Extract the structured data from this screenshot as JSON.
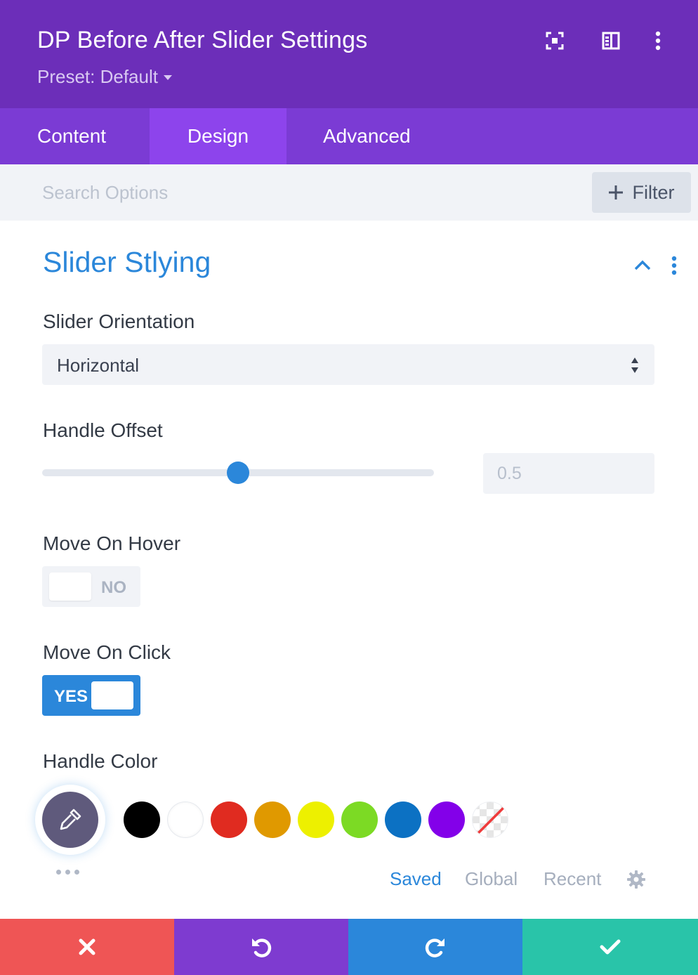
{
  "header": {
    "title": "DP Before After Slider Settings",
    "preset_label": "Preset: Default"
  },
  "tabs": [
    {
      "label": "Content"
    },
    {
      "label": "Design",
      "active": true
    },
    {
      "label": "Advanced"
    }
  ],
  "search": {
    "placeholder": "Search Options",
    "filter_label": "Filter"
  },
  "section": {
    "title": "Slider Stlying",
    "expanded": true
  },
  "fields": {
    "orientation": {
      "label": "Slider Orientation",
      "value": "Horizontal"
    },
    "handle_offset": {
      "label": "Handle Offset",
      "value": "0.5",
      "slider_fraction": 0.5
    },
    "move_on_hover": {
      "label": "Move On Hover",
      "state": "NO"
    },
    "move_on_click": {
      "label": "Move On Click",
      "state": "YES"
    },
    "handle_color": {
      "label": "Handle Color",
      "current_color": "#5f5a7c",
      "swatches": [
        "#000000",
        "#ffffff",
        "#e02b20",
        "#e09900",
        "#edf000",
        "#7cda24",
        "#0c71c3",
        "#8300e9",
        "transparent"
      ],
      "palette_tabs": [
        {
          "label": "Saved",
          "active": true
        },
        {
          "label": "Global"
        },
        {
          "label": "Recent"
        }
      ]
    }
  },
  "colors": {
    "header_bg": "#6c2eb9",
    "tabs_bg": "#7b3bd4",
    "active_tab_bg": "#8d44ec",
    "accent_blue": "#2b87da",
    "cancel_red": "#ef5555",
    "undo_purple": "#7e3bd0",
    "redo_blue": "#2b87da",
    "save_green": "#29c4a9"
  },
  "icons": {
    "header": [
      "focus-mode-icon",
      "split-view-icon",
      "kebab-menu-icon"
    ],
    "footer": [
      "close-icon",
      "undo-icon",
      "redo-icon",
      "check-icon"
    ]
  }
}
